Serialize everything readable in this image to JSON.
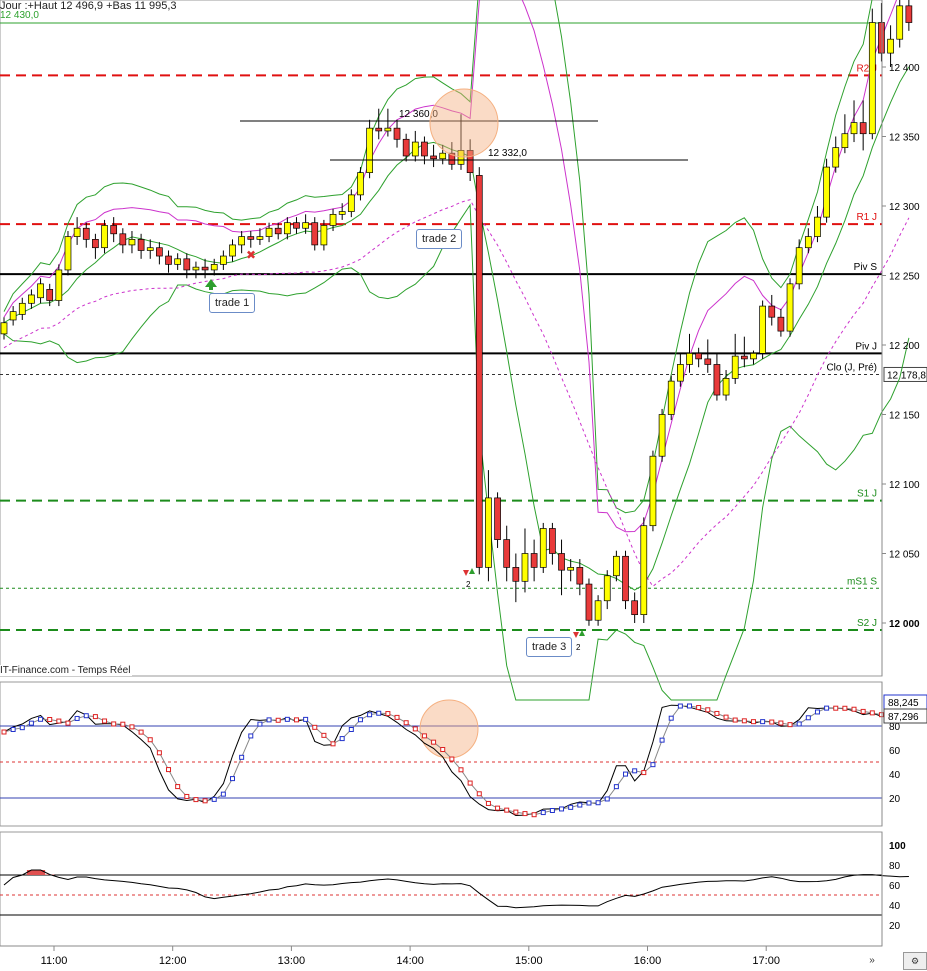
{
  "header": {
    "info": "Jour :+Haut 12 496,9 +Bas 11 995,3",
    "top_level": "12 430,0"
  },
  "source_label": "IT-Finance.com - Temps Réel",
  "colors": {
    "bull": "#ffff00",
    "bear": "#e83a3a",
    "bollinger": "#2ea12e",
    "envelope": "#cc33cc",
    "resistance": "#e01010",
    "support": "#1c8c1c",
    "pivot": "#000000",
    "stoch_k": "#000000",
    "stoch_d_up": "#2233cc",
    "stoch_d_down": "#dd2222",
    "hl_circle": "#f5b080",
    "osc_high": "#e05050",
    "osc_low": "#2e8b2e"
  },
  "trades": [
    {
      "label": "trade 1"
    },
    {
      "label": "trade 2"
    },
    {
      "label": "trade 3"
    }
  ],
  "annotations": {
    "level_hi": "12 360,0",
    "level_lo": "12 332,0",
    "marker_text": "2"
  },
  "chart_data": [
    {
      "type": "candlestick",
      "y_ticks": [
        12000,
        12050,
        12100,
        12150,
        12200,
        12250,
        12300,
        12350,
        12400
      ],
      "y_tick_labels": [
        "12 000",
        "12 050",
        "12 100",
        "12 150",
        "12 200",
        "12 250",
        "12 300",
        "12 350",
        "12 400"
      ],
      "ylim": [
        11970,
        12460
      ],
      "x_ticks": [
        "11:00",
        "12:00",
        "13:00",
        "14:00",
        "15:00",
        "16:00",
        "17:00"
      ],
      "levels": [
        {
          "label": "R2 J",
          "value": 12394,
          "kind": "resistance"
        },
        {
          "label": "R1 J",
          "value": 12287,
          "kind": "resistance"
        },
        {
          "label": "Piv S",
          "value": 12251,
          "kind": "pivot"
        },
        {
          "label": "Piv J",
          "value": 12194,
          "kind": "pivot"
        },
        {
          "label": "Clo (J, Pré)",
          "value": 12178.8,
          "kind": "close",
          "badge": "12 178,8"
        },
        {
          "label": "S1 J",
          "value": 12088,
          "kind": "support"
        },
        {
          "label": "mS1 S",
          "value": 12025,
          "kind": "minor"
        },
        {
          "label": "S2 J",
          "value": 11995,
          "kind": "support"
        }
      ],
      "candles": [
        [
          12208,
          12216,
          12204,
          12220
        ],
        [
          12218,
          12224,
          12214,
          12228
        ],
        [
          12222,
          12230,
          12218,
          12234
        ],
        [
          12230,
          12236,
          12226,
          12240
        ],
        [
          12234,
          12244,
          12230,
          12248
        ],
        [
          12240,
          12232,
          12228,
          12244
        ],
        [
          12232,
          12254,
          12228,
          12258
        ],
        [
          12254,
          12278,
          12250,
          12282
        ],
        [
          12278,
          12284,
          12272,
          12292
        ],
        [
          12284,
          12276,
          12270,
          12288
        ],
        [
          12276,
          12270,
          12262,
          12280
        ],
        [
          12270,
          12286,
          12266,
          12290
        ],
        [
          12286,
          12280,
          12274,
          12292
        ],
        [
          12280,
          12272,
          12266,
          12284
        ],
        [
          12272,
          12276,
          12266,
          12282
        ],
        [
          12276,
          12268,
          12262,
          12280
        ],
        [
          12268,
          12270,
          12262,
          12276
        ],
        [
          12270,
          12264,
          12258,
          12274
        ],
        [
          12264,
          12258,
          12252,
          12268
        ],
        [
          12258,
          12262,
          12254,
          12266
        ],
        [
          12262,
          12254,
          12248,
          12266
        ],
        [
          12254,
          12256,
          12248,
          12260
        ],
        [
          12256,
          12254,
          12248,
          12262
        ],
        [
          12254,
          12258,
          12250,
          12262
        ],
        [
          12258,
          12264,
          12254,
          12268
        ],
        [
          12264,
          12272,
          12260,
          12276
        ],
        [
          12272,
          12278,
          12266,
          12282
        ],
        [
          12278,
          12276,
          12270,
          12282
        ],
        [
          12276,
          12278,
          12272,
          12284
        ],
        [
          12278,
          12284,
          12274,
          12288
        ],
        [
          12284,
          12280,
          12276,
          12288
        ],
        [
          12280,
          12288,
          12276,
          12292
        ],
        [
          12288,
          12284,
          12280,
          12292
        ],
        [
          12284,
          12288,
          12280,
          12294
        ],
        [
          12288,
          12272,
          12268,
          12292
        ],
        [
          12272,
          12286,
          12268,
          12290
        ],
        [
          12286,
          12294,
          12282,
          12298
        ],
        [
          12294,
          12296,
          12290,
          12302
        ],
        [
          12296,
          12308,
          12292,
          12312
        ],
        [
          12308,
          12324,
          12304,
          12328
        ],
        [
          12324,
          12356,
          12320,
          12362
        ],
        [
          12356,
          12354,
          12348,
          12370
        ],
        [
          12354,
          12356,
          12350,
          12370
        ],
        [
          12356,
          12348,
          12342,
          12362
        ],
        [
          12348,
          12336,
          12332,
          12352
        ],
        [
          12336,
          12346,
          12332,
          12354
        ],
        [
          12346,
          12336,
          12330,
          12350
        ],
        [
          12336,
          12334,
          12328,
          12344
        ],
        [
          12334,
          12338,
          12330,
          12344
        ],
        [
          12338,
          12330,
          12326,
          12346
        ],
        [
          12330,
          12340,
          12326,
          12366
        ],
        [
          12340,
          12324,
          12318,
          12348
        ],
        [
          12322,
          12040,
          12035,
          12328
        ],
        [
          12040,
          12090,
          12030,
          12110
        ],
        [
          12090,
          12060,
          12054,
          12094
        ],
        [
          12060,
          12040,
          12030,
          12070
        ],
        [
          12040,
          12030,
          12015,
          12050
        ],
        [
          12030,
          12050,
          12022,
          12068
        ],
        [
          12050,
          12040,
          12030,
          12060
        ],
        [
          12040,
          12068,
          12036,
          12072
        ],
        [
          12068,
          12050,
          12042,
          12072
        ],
        [
          12050,
          12038,
          12020,
          12060
        ],
        [
          12038,
          12040,
          12030,
          12046
        ],
        [
          12040,
          12028,
          12020,
          12046
        ],
        [
          12028,
          12002,
          11998,
          12032
        ],
        [
          12002,
          12016,
          11998,
          12020
        ],
        [
          12016,
          12034,
          12010,
          12038
        ],
        [
          12034,
          12048,
          12030,
          12052
        ],
        [
          12048,
          12016,
          12010,
          12052
        ],
        [
          12016,
          12006,
          12000,
          12022
        ],
        [
          12006,
          12070,
          12000,
          12076
        ],
        [
          12070,
          12120,
          12066,
          12124
        ],
        [
          12120,
          12150,
          12116,
          12154
        ],
        [
          12150,
          12174,
          12146,
          12178
        ],
        [
          12174,
          12186,
          12170,
          12194
        ],
        [
          12186,
          12194,
          12180,
          12208
        ],
        [
          12194,
          12190,
          12184,
          12198
        ],
        [
          12190,
          12186,
          12180,
          12204
        ],
        [
          12186,
          12164,
          12160,
          12194
        ],
        [
          12164,
          12176,
          12160,
          12182
        ],
        [
          12176,
          12192,
          12172,
          12208
        ],
        [
          12192,
          12190,
          12184,
          12206
        ],
        [
          12190,
          12194,
          12186,
          12196
        ],
        [
          12194,
          12228,
          12190,
          12232
        ],
        [
          12228,
          12220,
          12214,
          12236
        ],
        [
          12220,
          12210,
          12206,
          12226
        ],
        [
          12210,
          12244,
          12206,
          12248
        ],
        [
          12244,
          12270,
          12240,
          12276
        ],
        [
          12270,
          12278,
          12266,
          12284
        ],
        [
          12278,
          12292,
          12274,
          12300
        ],
        [
          12292,
          12328,
          12288,
          12334
        ],
        [
          12328,
          12342,
          12324,
          12350
        ],
        [
          12342,
          12352,
          12338,
          12366
        ],
        [
          12352,
          12360,
          12346,
          12376
        ],
        [
          12360,
          12352,
          12340,
          12376
        ],
        [
          12352,
          12432,
          12348,
          12442
        ],
        [
          12432,
          12410,
          12404,
          12446
        ],
        [
          12410,
          12420,
          12400,
          12430
        ],
        [
          12420,
          12444,
          12414,
          12460
        ],
        [
          12444,
          12432,
          12426,
          12460
        ]
      ]
    },
    {
      "type": "line",
      "name": "stochastic",
      "y_ticks": [
        20,
        40,
        60,
        80,
        100
      ],
      "ylim": [
        0,
        105
      ],
      "value_labels": [
        "88,245",
        "87,296"
      ]
    },
    {
      "type": "area",
      "name": "oscillator",
      "y_ticks": [
        20,
        40,
        60,
        80,
        100
      ],
      "ylim": [
        0,
        105
      ]
    }
  ]
}
